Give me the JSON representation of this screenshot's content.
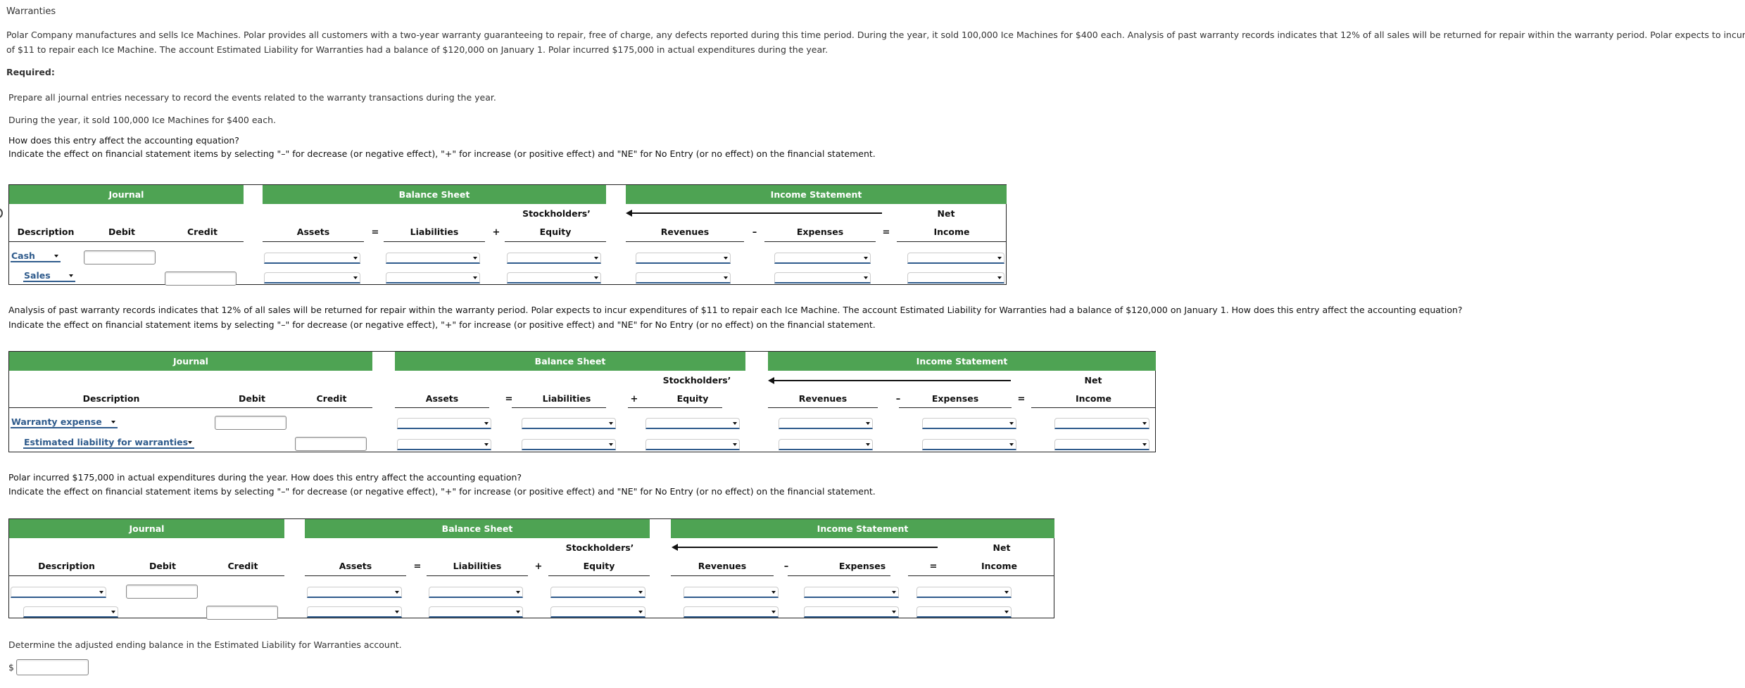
{
  "page": {
    "title": "Warranties",
    "intro_line1": "Polar Company manufactures and sells Ice Machines. Polar provides all customers with a two-year warranty guaranteeing to repair, free of charge, any defects reported during this time period. During the year, it sold 100,000 Ice Machines for $400 each. Analysis of past warranty records indicates that 12% of all sales will be returned for repair within the warranty period. Polar expects to incur expenditures",
    "intro_line2": "of $11 to repair each Ice Machine. The account Estimated Liability for Warranties had a balance of $120,000 on January 1. Polar incurred $175,000 in actual expenditures during the year.",
    "required_label": "Required:",
    "prepare_text": "Prepare all journal entries necessary to record the events related to the warranty transactions during the year."
  },
  "instruction": "Indicate the effect on financial statement items by selecting \"–\" for decrease (or negative effect), \"+\" for increase (or positive effect) and \"NE\" for No Entry (or no effect) on the financial statement.",
  "headers": {
    "journal": "Journal",
    "balance_sheet": "Balance Sheet",
    "income_statement": "Income Statement",
    "description": "Description",
    "debit": "Debit",
    "credit": "Credit",
    "assets": "Assets",
    "liabilities": "Liabilities",
    "stockholders": "Stockholders’",
    "equity": "Equity",
    "revenues": "Revenues",
    "expenses": "Expenses",
    "net": "Net",
    "income": "Income",
    "op_equals": "=",
    "op_plus": "+",
    "op_minus": "–"
  },
  "entries": [
    {
      "event_text": "During the year, it sold 100,000 Ice Machines for $400 each.",
      "question": "How does this entry affect the accounting equation?",
      "rows": [
        {
          "account": "Cash",
          "debit": "",
          "credit": "",
          "assets": "",
          "liabilities": "",
          "equity": "",
          "revenues": "",
          "expenses": "",
          "net_income": ""
        },
        {
          "account": "Sales",
          "debit": "",
          "credit": "",
          "assets": "",
          "liabilities": "",
          "equity": "",
          "revenues": "",
          "expenses": "",
          "net_income": ""
        }
      ]
    },
    {
      "event_text": "Analysis of past warranty records indicates that 12% of all sales will be returned for repair within the warranty period. Polar expects to incur expenditures of $11 to repair each Ice Machine. The account Estimated Liability for Warranties had a balance of $120,000 on January 1. How does this entry affect the accounting equation?",
      "rows": [
        {
          "account": "Warranty expense",
          "debit": "",
          "credit": "",
          "assets": "",
          "liabilities": "",
          "equity": "",
          "revenues": "",
          "expenses": "",
          "net_income": ""
        },
        {
          "account": "Estimated liability for warranties",
          "debit": "",
          "credit": "",
          "assets": "",
          "liabilities": "",
          "equity": "",
          "revenues": "",
          "expenses": "",
          "net_income": ""
        }
      ]
    },
    {
      "event_text": "Polar incurred $175,000 in actual expenditures during the year. How does this entry affect the accounting equation?",
      "rows": [
        {
          "account": "",
          "debit": "",
          "credit": "",
          "assets": "",
          "liabilities": "",
          "equity": "",
          "revenues": "",
          "expenses": "",
          "net_income": ""
        },
        {
          "account": "",
          "debit": "",
          "credit": "",
          "assets": "",
          "liabilities": "",
          "equity": "",
          "revenues": "",
          "expenses": "",
          "net_income": ""
        }
      ]
    }
  ],
  "final": {
    "question": "Determine the adjusted ending balance in the Estimated Liability for Warranties account.",
    "currency_symbol": "$",
    "value": ""
  },
  "colors": {
    "header_green": "#4ea353",
    "link_blue": "#2f5b8c"
  }
}
